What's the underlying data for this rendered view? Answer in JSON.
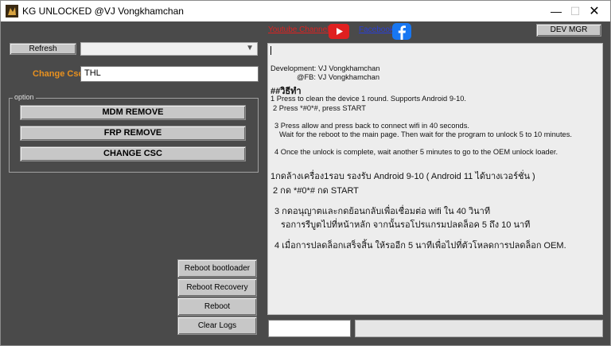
{
  "window": {
    "title": "KG UNLOCKED @VJ Vongkhamchan",
    "minimize_glyph": "—",
    "maximize_glyph": "☐",
    "close_glyph": "✕",
    "app_icon": "app-logo-icon"
  },
  "left_panel": {
    "refresh_label": "Refresh",
    "device_combo_value": "",
    "change_csc_label": "Change Csc:",
    "csc_value": "THL",
    "option_group_label": "option",
    "buttons": {
      "mdm_remove": "MDM REMOVE",
      "frp_remove": "FRP REMOVE",
      "change_csc": "CHANGE CSC"
    },
    "reboot_buttons": {
      "bootloader": "Reboot  bootloader",
      "recovery": "Reboot Recovery",
      "reboot": "Reboot",
      "clear_logs": "Clear Logs"
    }
  },
  "header_links": {
    "youtube_label": "Youtube Channels",
    "facebook_label": "Facebook",
    "dev_mgr_label": "DEV MGR"
  },
  "log": {
    "lines": [
      "Development:  VJ Vongkhamchan",
      "@FB: VJ Vongkhamchan",
      "##วิธีทำ",
      "1 Press to clean the device 1 round. Supports Android 9-10.",
      "2 Press *#0*#, press START",
      "3 Press allow and press back to connect wifi in 40 seconds.",
      "Wait for the reboot to the main page. Then wait for the program to unlock 5 to 10 minutes.",
      "4 Once the unlock is complete, wait another 5 minutes to go to the OEM unlock loader.",
      "1กดล้างเครื่อง1รอบ รองรับ Android 9-10 ( Android 11 ได้บางเวอร์ชั่น )",
      "2 กด *#0*# กด START",
      "3 กดอนุญาตและกดย้อนกลับเพื่อเชื่อมต่อ wifi ใน 40 วินาที",
      "รอการรีบูตไปที่หน้าหลัก จากนั้นรอโปรแกรมปลดล็อค 5 ถึง 10 นาที",
      "4 เมื่อการปลดล็อกเสร็จสิ้น ให้รออีก 5 นาทีเพื่อไปที่ตัวโหลดการปลดล็อก OEM."
    ]
  },
  "bottom": {
    "input_value": "",
    "status_text": ""
  },
  "colors": {
    "background": "#4a4a4a",
    "accent_label": "#e8911f",
    "youtube_red": "#e02020",
    "facebook_blue": "#1877f2"
  }
}
